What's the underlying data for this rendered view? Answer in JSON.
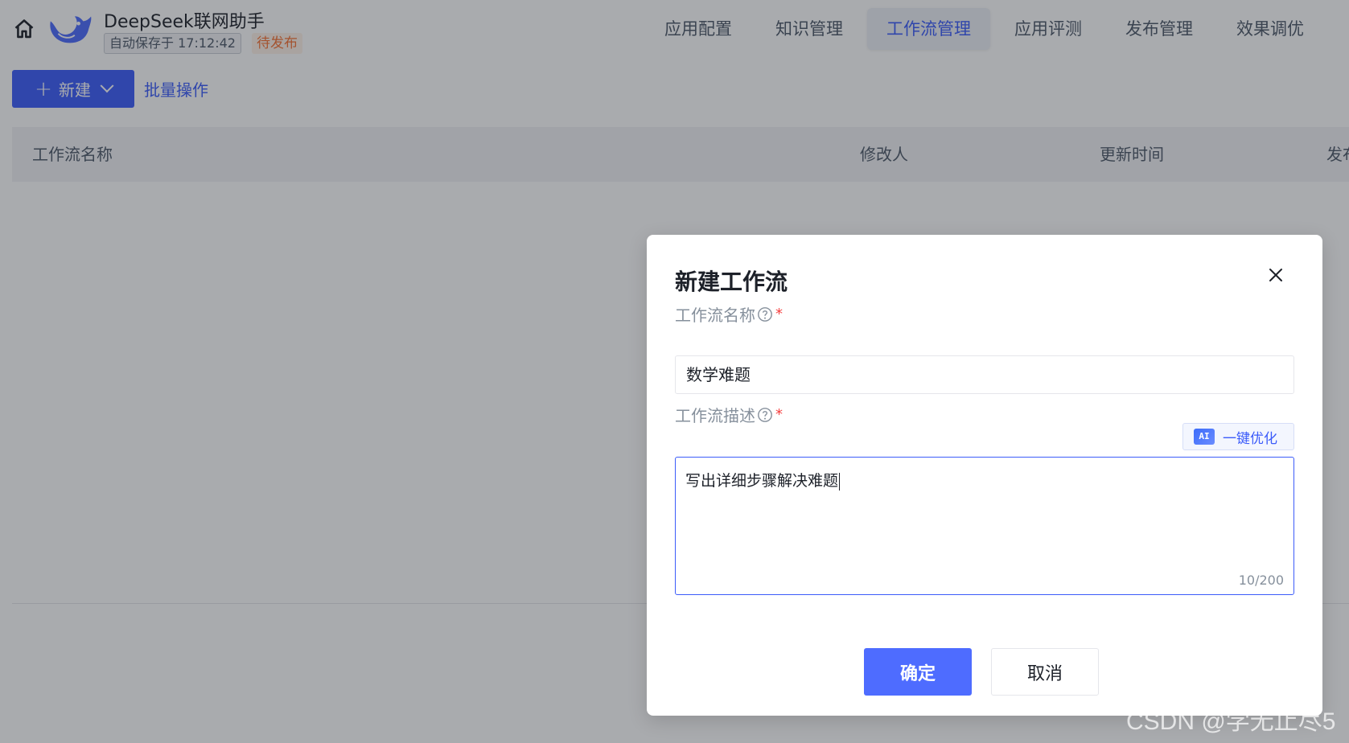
{
  "header": {
    "app_name": "DeepSeek联网助手",
    "autosave": "自动保存于 17:12:42",
    "status": "待发布"
  },
  "nav": {
    "items": [
      {
        "label": "应用配置"
      },
      {
        "label": "知识管理"
      },
      {
        "label": "工作流管理",
        "active": true
      },
      {
        "label": "应用评测"
      },
      {
        "label": "发布管理"
      },
      {
        "label": "效果调优"
      }
    ]
  },
  "toolbar": {
    "new_label": "新建",
    "batch_label": "批量操作"
  },
  "table": {
    "columns": [
      "工作流名称",
      "修改人",
      "更新时间",
      "发布"
    ]
  },
  "modal": {
    "title": "新建工作流",
    "name_label": "工作流名称",
    "name_value": "数学难题",
    "desc_label": "工作流描述",
    "optimize_badge": "AI",
    "optimize_label": "一键优化",
    "desc_value": "写出详细步骤解决难题",
    "counter": "10/200",
    "confirm_label": "确定",
    "cancel_label": "取消"
  },
  "watermark": "CSDN @学无止尽5",
  "colors": {
    "primary": "#3c5cfa",
    "confirm": "#4e6cff",
    "pending": "#f77234",
    "required": "#f53f3f"
  }
}
